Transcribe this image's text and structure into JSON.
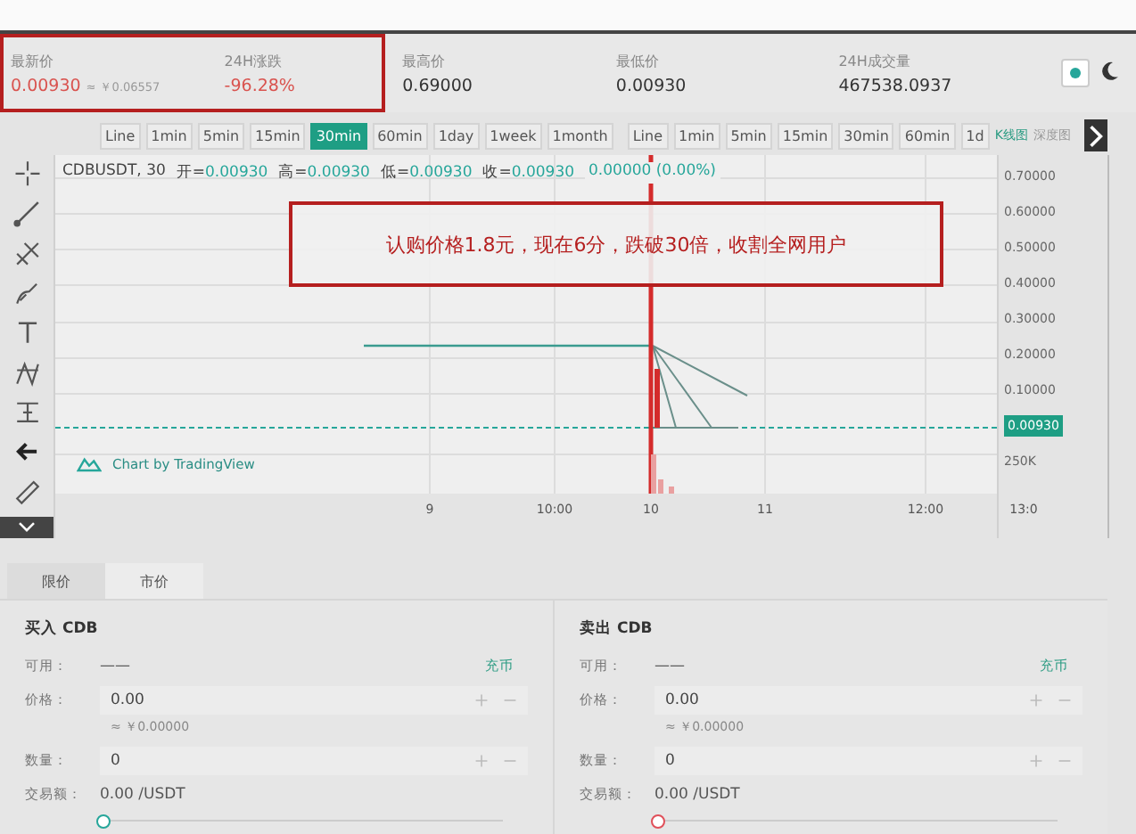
{
  "header": {
    "stats": [
      {
        "label": "最新价",
        "value": "0.00930",
        "sub": "≈ ￥0.06557",
        "color": "#d9534f"
      },
      {
        "label": "24H涨跌",
        "value": "-96.28%",
        "color": "#d9534f"
      },
      {
        "label": "最高价",
        "value": "0.69000",
        "color": "#333333"
      },
      {
        "label": "最低价",
        "value": "0.00930",
        "color": "#333333"
      },
      {
        "label": "24H成交量",
        "value": "467538.0937",
        "color": "#333333"
      }
    ],
    "theme": [
      {
        "kind": "sun",
        "selected": true
      },
      {
        "kind": "moon",
        "selected": false
      }
    ]
  },
  "intervals": [
    {
      "label": "Line",
      "selected": false
    },
    {
      "label": "1min",
      "selected": false
    },
    {
      "label": "5min",
      "selected": false
    },
    {
      "label": "15min",
      "selected": false
    },
    {
      "label": "30min",
      "selected": true
    },
    {
      "label": "60min",
      "selected": false
    },
    {
      "label": "1day",
      "selected": false
    },
    {
      "label": "1week",
      "selected": false
    },
    {
      "label": "1month",
      "selected": false
    }
  ],
  "intervals_2": [
    {
      "label": "Line",
      "selected": false
    },
    {
      "label": "1min",
      "selected": false
    },
    {
      "label": "5min",
      "selected": false
    },
    {
      "label": "15min",
      "selected": false
    },
    {
      "label": "30min",
      "selected": false
    },
    {
      "label": "60min",
      "selected": false
    },
    {
      "label": "1d",
      "selected": false
    }
  ],
  "chart_views": [
    {
      "label": "K线图",
      "selected": true
    },
    {
      "label": "深度图",
      "selected": false
    }
  ],
  "tools": [
    {
      "kind": "crosshair"
    },
    {
      "kind": "line"
    },
    {
      "kind": "fork"
    },
    {
      "kind": "brush"
    },
    {
      "kind": "text"
    },
    {
      "kind": "pattern"
    },
    {
      "kind": "measure"
    },
    {
      "kind": "back"
    },
    {
      "kind": "ruler"
    }
  ],
  "chart": {
    "symbol": "CDBUSDT, 30",
    "ohlc": [
      {
        "label": "开=",
        "value": "0.00930"
      },
      {
        "label": "高=",
        "value": "0.00930"
      },
      {
        "label": "低=",
        "value": "0.00930"
      },
      {
        "label": "收=",
        "value": "0.00930"
      }
    ],
    "change": "0.00000 (0.00%)",
    "y_ticks": [
      "0.70000",
      "0.60000",
      "0.50000",
      "0.40000",
      "0.30000",
      "0.20000",
      "0.10000"
    ],
    "price_tag": "0.00930",
    "volume_tick": "250K",
    "x_ticks": [
      "9",
      "10:00",
      "10",
      "11",
      "12:00",
      "13:0"
    ],
    "brand": "Chart by TradingView",
    "annotation": "认购价格1.8元，现在6分，跌破30倍，收割全网用户"
  },
  "order_tabs": [
    {
      "label": "限价",
      "selected": true
    },
    {
      "label": "市价",
      "selected": false
    }
  ],
  "panels": [
    {
      "color": "#26a69a",
      "title": "买入 CDB",
      "available_label": "可用：",
      "available": "——",
      "deposit": "充币",
      "price_label": "价格：",
      "price": "0.00",
      "approx": "≈ ￥0.00000",
      "qty_label": "数量：",
      "qty": "0",
      "total_label": "交易额：",
      "total": "0.00 /USDT",
      "level": 0
    },
    {
      "color": "#e0505a",
      "title": "卖出 CDB",
      "available_label": "可用：",
      "available": "——",
      "deposit": "充币",
      "price_label": "价格：",
      "price": "0.00",
      "approx": "≈ ￥0.00000",
      "qty_label": "数量：",
      "qty": "0",
      "total_label": "交易额：",
      "total": "0.00 /USDT",
      "level": 0
    }
  ]
}
